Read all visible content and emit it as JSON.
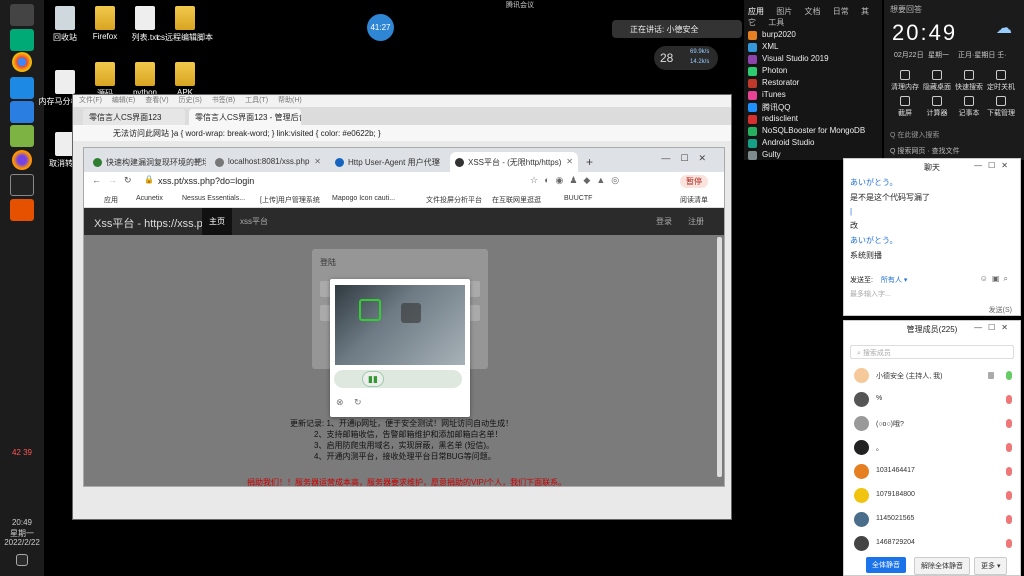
{
  "desktop": {
    "icons": [
      {
        "label": "回收站"
      },
      {
        "label": "Firefox"
      },
      {
        "label": "列表.txt"
      },
      {
        "label": "cs远程编辑脚本"
      },
      {
        "label": "内存马分析.jpg"
      },
      {
        "label": "源码"
      },
      {
        "label": "python"
      },
      {
        "label": "APK"
      },
      {
        "label": "取消转账"
      }
    ]
  },
  "taskbar": {
    "temp1": "42",
    "temp2": "39",
    "time": "20:49",
    "weekday": "星期一",
    "date": "2022/2/22"
  },
  "overlay": {
    "wechat_top": "腾讯会议",
    "clock_bubble": "41:27",
    "voice_pill": "正在讲话: 小德安全",
    "net_badge": "28",
    "net_up": "69.9k/s",
    "net_down": "14.2k/s"
  },
  "outer_browser": {
    "menu": [
      "文件(F)",
      "编辑(E)",
      "查看(V)",
      "历史(S)",
      "书签(B)",
      "工具(T)",
      "帮助(H)"
    ],
    "tabs": [
      {
        "label": "零信言人CS界面123"
      },
      {
        "label": "零信言人CS界面123 - 管理后台"
      }
    ],
    "address": "无法访问此网站 }a { word-wrap: break-word; } link:visited { color: #e0622b; }"
  },
  "chrome": {
    "tabs": [
      {
        "label": "快速构建漏洞复现环境的靶场"
      },
      {
        "label": "localhost:8081/xss.php"
      },
      {
        "label": "Http User-Agent 用户代理"
      },
      {
        "label": "XSS平台 - (无限http/https)"
      }
    ],
    "address": "xss.pt/xss.php?do=login",
    "suspended_label": "暂停",
    "bookmarks": [
      "应用",
      "Acunetix",
      "Nessus Essentials...",
      "[上传]用户管理系统",
      "Mapogo Icon cauti...",
      "文件投屏分析平台",
      "在互联网里逛逛",
      "BUUCTF",
      "阅读清单"
    ]
  },
  "site": {
    "brand": "Xss平台 - https://xss.pt",
    "nav": [
      "主页",
      "xss平台"
    ],
    "nav_right": [
      "登录",
      "注册"
    ],
    "panel_title": "登陆",
    "notes": [
      "更新记录: 1、开通ip网址，便于安全测试！网址访问自动生成！",
      "2、支持邮箱收信，告警邮箱维护和添加邮箱白名单！",
      "3、启用防爬虫用域名，实现屏蔽，黑名单 (短信)。",
      "4、开通内测平台，接收处理平台日常BUG等问题。"
    ],
    "warning": "捐助我们！！服务器运营成本高，服务器要求维护，愿意捐助的VIP/个人，我们下面联系。"
  },
  "search_panel": {
    "tabs": [
      "应用",
      "图片",
      "文档",
      "日常",
      "其它",
      "工具"
    ],
    "items": [
      {
        "label": "burp2020",
        "color": "#e67e22"
      },
      {
        "label": "XML",
        "color": "#3498db"
      },
      {
        "label": "Visual Studio 2019",
        "color": "#8e44ad"
      },
      {
        "label": "Photon",
        "color": "#2ecc71"
      },
      {
        "label": "Restorator",
        "color": "#c0392b"
      },
      {
        "label": "iTunes",
        "color": "#e84393"
      },
      {
        "label": "腾讯QQ",
        "color": "#1e90ff"
      },
      {
        "label": "redisclient",
        "color": "#d63031"
      },
      {
        "label": "NoSQLBooster for MongoDB",
        "color": "#27ae60"
      },
      {
        "label": "Android Studio",
        "color": "#16a085"
      },
      {
        "label": "Gulty",
        "color": "#7f8c8d"
      }
    ]
  },
  "quick_panel": {
    "label": "想要回答",
    "time": "20:49",
    "date": "02月22日",
    "weekday": "星期一",
    "lunar": "正月·星期日 壬·",
    "buttons": [
      "清理内存",
      "隐藏桌面",
      "快速搜索",
      "定时关机",
      "截屏",
      "计算器",
      "记事本",
      "下载管理"
    ],
    "search_hint1": "Q 在此键入搜索",
    "search_hint2": "Q 搜索网页 · 查找文件"
  },
  "chat_window": {
    "title": "聊天",
    "messages": [
      {
        "text": "あいがとう。",
        "color": "#1e6fd9"
      },
      {
        "text": "是不是这个代码写漏了",
        "color": "#222"
      },
      {
        "text": "|",
        "color": "#1e6fd9"
      },
      {
        "text": "改",
        "color": "#222"
      },
      {
        "text": "あいがとう。",
        "color": "#1e6fd9"
      },
      {
        "text": "系统则播",
        "color": "#222"
      }
    ],
    "send_to": "发送至:",
    "recipient": "所有人 ▾",
    "input_placeholder": "最多输入字...",
    "send_label": "发送(S)"
  },
  "member_window": {
    "title": "管理成员(225)",
    "search_placeholder": "搜索成员",
    "members": [
      {
        "name": "小德安全 (主持人, 我)",
        "color": "#f5c99a"
      },
      {
        "name": "%",
        "color": "#555"
      },
      {
        "name": "(○o○)哦?",
        "color": "#999"
      },
      {
        "name": "。",
        "color": "#222"
      },
      {
        "name": "1031464417",
        "color": "#e67e22"
      },
      {
        "name": "1079184800",
        "color": "#f1c40f"
      },
      {
        "name": "1145021565",
        "color": "#4a6d8c"
      },
      {
        "name": "1468729204",
        "color": "#444"
      }
    ],
    "btn_mute_all": "全体静音",
    "btn_unmute_all": "解除全体静音",
    "btn_more": "更多 ▾"
  }
}
